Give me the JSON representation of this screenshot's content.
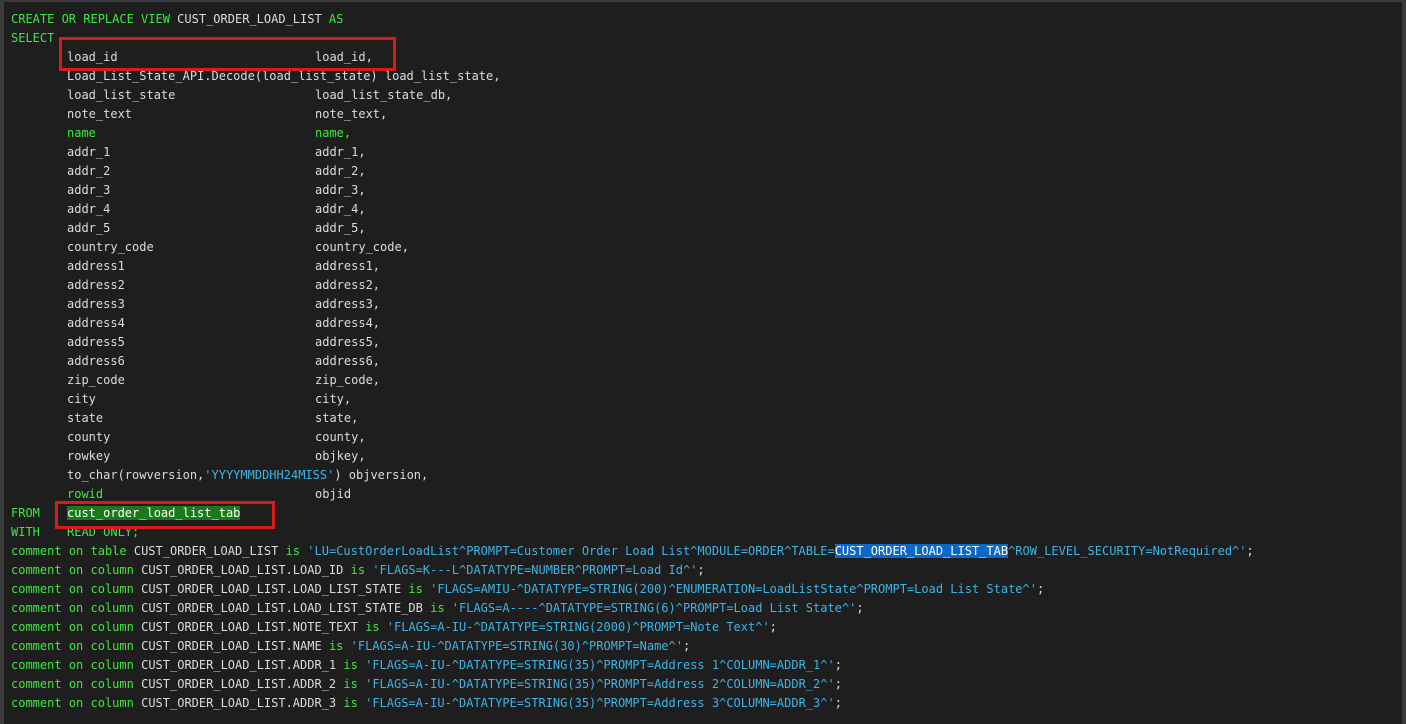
{
  "editor": {
    "header": [
      {
        "t": "CREATE OR REPLACE VIEW ",
        "k": "kw"
      },
      {
        "t": "CUST_ORDER_LOAD_LIST ",
        "k": "pl"
      },
      {
        "t": "AS",
        "k": "kw"
      }
    ],
    "select_kw": "SELECT",
    "columns": [
      {
        "a": "load_id",
        "b": "load_id,"
      },
      {
        "full": "Load_List_State_API.Decode(load_list_state) load_list_state,"
      },
      {
        "a": "load_list_state",
        "b": "load_list_state_db,"
      },
      {
        "a": "note_text",
        "b": "note_text,"
      },
      {
        "a": "name",
        "b": "name,",
        "kw": true
      },
      {
        "a": "addr_1",
        "b": "addr_1,"
      },
      {
        "a": "addr_2",
        "b": "addr_2,"
      },
      {
        "a": "addr_3",
        "b": "addr_3,"
      },
      {
        "a": "addr_4",
        "b": "addr_4,"
      },
      {
        "a": "addr_5",
        "b": "addr_5,"
      },
      {
        "a": "country_code",
        "b": "country_code,"
      },
      {
        "a": "address1",
        "b": "address1,"
      },
      {
        "a": "address2",
        "b": "address2,"
      },
      {
        "a": "address3",
        "b": "address3,"
      },
      {
        "a": "address4",
        "b": "address4,"
      },
      {
        "a": "address5",
        "b": "address5,"
      },
      {
        "a": "address6",
        "b": "address6,"
      },
      {
        "a": "zip_code",
        "b": "zip_code,"
      },
      {
        "a": "city",
        "b": "city,"
      },
      {
        "a": "state",
        "b": "state,"
      },
      {
        "a": "county",
        "b": "county,"
      },
      {
        "a": "rowkey",
        "b": "objkey,"
      },
      {
        "pre": "to_char(rowversion,",
        "s": "'YYYYMMDDHH24MISS'",
        "post": ") objversion,"
      },
      {
        "a": "rowid",
        "b": "objid",
        "akw": true
      }
    ],
    "from_kw": "FROM",
    "from_table": "cust_order_load_list_tab",
    "with_kw": "WITH",
    "with_rest": "READ ONLY;",
    "comments": [
      {
        "what": "table",
        "obj": "CUST_ORDER_LOAD_LIST",
        "s1": "'LU=CustOrderLoadList^PROMPT=Customer Order Load List^MODULE=ORDER^TABLE=",
        "sel": "CUST_ORDER_LOAD_LIST_TAB",
        "s2": "^ROW_LEVEL_SECURITY=NotRequired^'"
      },
      {
        "what": "column",
        "obj": "CUST_ORDER_LOAD_LIST.LOAD_ID",
        "s1": "'FLAGS=K---L^DATATYPE=NUMBER^PROMPT=Load Id^'"
      },
      {
        "what": "column",
        "obj": "CUST_ORDER_LOAD_LIST.LOAD_LIST_STATE",
        "s1": "'FLAGS=AMIU-^DATATYPE=STRING(200)^ENUMERATION=LoadListState^PROMPT=Load List State^'"
      },
      {
        "what": "column",
        "obj": "CUST_ORDER_LOAD_LIST.LOAD_LIST_STATE_DB",
        "s1": "'FLAGS=A----^DATATYPE=STRING(6)^PROMPT=Load List State^'"
      },
      {
        "what": "column",
        "obj": "CUST_ORDER_LOAD_LIST.NOTE_TEXT",
        "s1": "'FLAGS=A-IU-^DATATYPE=STRING(2000)^PROMPT=Note Text^'"
      },
      {
        "what": "column",
        "obj": "CUST_ORDER_LOAD_LIST.NAME",
        "s1": "'FLAGS=A-IU-^DATATYPE=STRING(30)^PROMPT=Name^'"
      },
      {
        "what": "column",
        "obj": "CUST_ORDER_LOAD_LIST.ADDR_1",
        "s1": "'FLAGS=A-IU-^DATATYPE=STRING(35)^PROMPT=Address 1^COLUMN=ADDR_1^'"
      },
      {
        "what": "column",
        "obj": "CUST_ORDER_LOAD_LIST.ADDR_2",
        "s1": "'FLAGS=A-IU-^DATATYPE=STRING(35)^PROMPT=Address 2^COLUMN=ADDR_2^'"
      },
      {
        "what": "column",
        "obj": "CUST_ORDER_LOAD_LIST.ADDR_3",
        "s1": "'FLAGS=A-IU-^DATATYPE=STRING(35)^PROMPT=Address 3^COLUMN=ADDR_3^'"
      }
    ],
    "kw_comment": "comment",
    "kw_on": "on",
    "kw_is": "is",
    "kw_semicolon": ";",
    "colors": {
      "keyword": "#3ee83e",
      "string": "#3fb4e6",
      "plain": "#dcdcdc",
      "selection": "#0a68c7",
      "highlight": "#1a7a1a",
      "annotation_box": "#d81c1c"
    }
  }
}
